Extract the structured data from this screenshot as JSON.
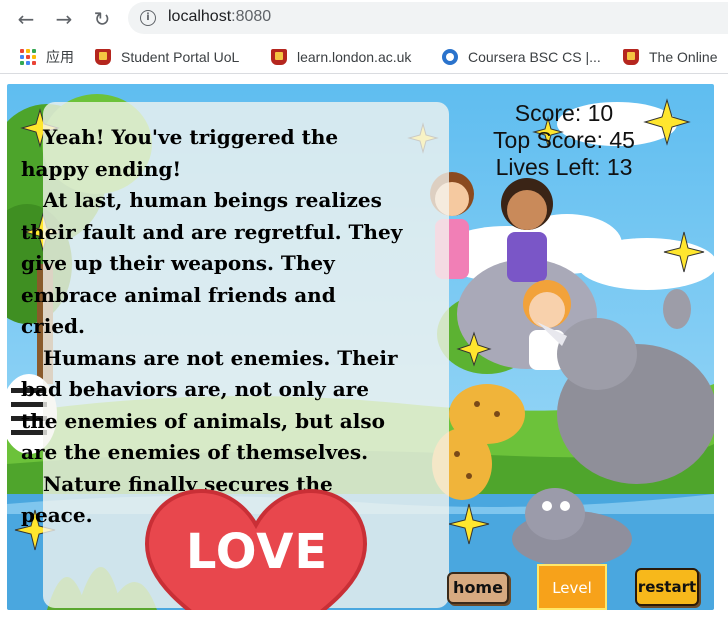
{
  "browser": {
    "url_host": "localhost",
    "url_port": ":8080",
    "bookmarks": [
      {
        "label": "应用",
        "icon": "apps-grid-icon"
      },
      {
        "label": "Student Portal UoL",
        "icon": "university-shield-icon"
      },
      {
        "label": "learn.london.ac.uk",
        "icon": "university-shield-icon"
      },
      {
        "label": "Coursera BSC CS |...",
        "icon": "coursera-icon"
      },
      {
        "label": "The Online",
        "icon": "university-shield-icon"
      }
    ]
  },
  "game": {
    "story": [
      "Yeah! You've triggered the happy ending!",
      "At last, human beings realizes their fault and are regretful. They give up their weapons. They embrace animal friends and cried.",
      "Humans are not enemies. Their bad behaviors are, not only are the enemies of animals, but also are the enemies of themselves.",
      "Nature finally secures the peace."
    ],
    "love_label": "LOVE",
    "hud": {
      "score": "Score: 10",
      "top_score": "Top Score: 45",
      "lives": "Lives Left: 13"
    },
    "buttons": {
      "home": "home",
      "level": "Level",
      "restart": "restart"
    },
    "colors": {
      "sky": "#7ecbf2",
      "grass": "#6cc23a",
      "water": "#4aa7df",
      "heart": "#e8474d",
      "star": "#ffe62e"
    }
  }
}
